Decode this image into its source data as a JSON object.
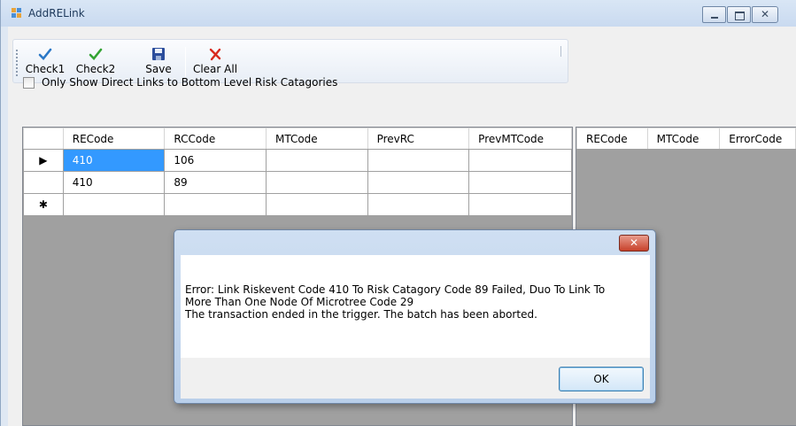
{
  "window": {
    "title": "AddRELink",
    "icon": "app-window-icon"
  },
  "toolbar": {
    "buttons": [
      {
        "label": "Check1",
        "icon": "check-icon",
        "color": "#2b78c7"
      },
      {
        "label": "Check2",
        "icon": "check-icon",
        "color": "#33a333"
      },
      {
        "label": "Save",
        "icon": "save-icon",
        "color": "#2b4d9c"
      },
      {
        "label": "Clear All",
        "icon": "clear-icon",
        "color": "#d8291d"
      }
    ]
  },
  "filter": {
    "checkbox_label": "Only Show Direct Links to Bottom Level Risk Catagories",
    "checked": false
  },
  "left_grid": {
    "columns": [
      "RECode",
      "RCCode",
      "MTCode",
      "PrevRC",
      "PrevMTCode"
    ],
    "rows": [
      {
        "indicator": "▶",
        "cells": [
          "410",
          "106",
          "",
          "",
          ""
        ]
      },
      {
        "indicator": "",
        "cells": [
          "410",
          "89",
          "",
          "",
          ""
        ]
      },
      {
        "indicator": "✱",
        "cells": [
          "",
          "",
          "",
          "",
          ""
        ]
      }
    ]
  },
  "right_grid": {
    "columns": [
      "RECode",
      "MTCode",
      "ErrorCode"
    ]
  },
  "dialog": {
    "close_label": "✕",
    "message_lines": [
      "Error: Link Riskevent Code 410 To Risk Catagory Code 89 Failed, Duo To Link To",
      "More Than One Node Of Microtree Code 29",
      "The transaction ended in the trigger. The batch has been aborted."
    ],
    "ok_label": "OK"
  }
}
